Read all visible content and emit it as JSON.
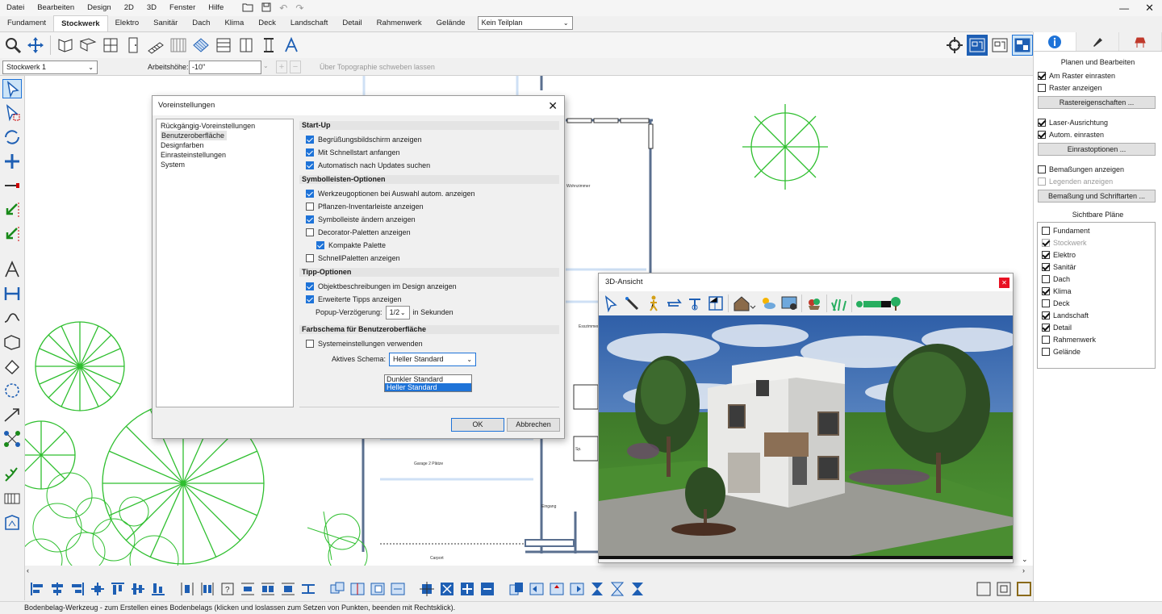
{
  "menu": [
    "Datei",
    "Bearbeiten",
    "Design",
    "2D",
    "3D",
    "Fenster",
    "Hilfe"
  ],
  "tabs": [
    "Fundament",
    "Stockwerk",
    "Elektro",
    "Sanitär",
    "Dach",
    "Klima",
    "Deck",
    "Landschaft",
    "Detail",
    "Rahmenwerk",
    "Gelände"
  ],
  "active_tab": "Stockwerk",
  "plan_select": "Kein Teilplan",
  "options_bar": {
    "floor_select": "Stockwerk 1",
    "height_label": "Arbeitshöhe:",
    "height_value": "-10\"",
    "topo_label": "Über Topographie schweben lassen"
  },
  "right_panel": {
    "title": "Planen und Bearbeiten",
    "snap_grid": "Am Raster einrasten",
    "show_grid": "Raster anzeigen",
    "grid_props_btn": "Rastereigenschaften ...",
    "laser": "Laser-Ausrichtung",
    "auto_snap": "Autom. einrasten",
    "snap_opts_btn": "Einrastoptionen ...",
    "show_dims": "Bemaßungen anzeigen",
    "show_legends": "Legenden anzeigen",
    "dims_fonts_btn": "Bemaßung und Schriftarten ...",
    "visible_plans_title": "Sichtbare Pläne",
    "visible_plans": [
      {
        "label": "Fundament",
        "checked": false
      },
      {
        "label": "Stockwerk",
        "checked": true,
        "grey": true
      },
      {
        "label": "Elektro",
        "checked": true
      },
      {
        "label": "Sanitär",
        "checked": true
      },
      {
        "label": "Dach",
        "checked": false
      },
      {
        "label": "Klima",
        "checked": true
      },
      {
        "label": "Deck",
        "checked": false
      },
      {
        "label": "Landschaft",
        "checked": true
      },
      {
        "label": "Detail",
        "checked": true
      },
      {
        "label": "Rahmenwerk",
        "checked": false
      },
      {
        "label": "Gelände",
        "checked": false
      }
    ]
  },
  "dialog": {
    "title": "Voreinstellungen",
    "nav": [
      "Rückgängig-Voreinstellungen",
      "Benutzeroberfläche",
      "Designfarben",
      "Einrasteinstellungen",
      "System"
    ],
    "nav_selected": 1,
    "startup_title": "Start-Up",
    "startup": [
      {
        "label": "Begrüßungsbildschirm anzeigen",
        "checked": true
      },
      {
        "label": "Mit Schnellstart anfangen",
        "checked": true
      },
      {
        "label": "Automatisch nach Updates suchen",
        "checked": true
      }
    ],
    "toolbar_title": "Symbolleisten-Optionen",
    "toolbar": [
      {
        "label": "Werkzeugoptionen bei Auswahl autom. anzeigen",
        "checked": true
      },
      {
        "label": "Pflanzen-Inventarleiste anzeigen",
        "checked": false
      },
      {
        "label": "Symbolleiste ändern anzeigen",
        "checked": true
      },
      {
        "label": "Decorator-Paletten anzeigen",
        "checked": false
      },
      {
        "label": "Kompakte Palette",
        "checked": true,
        "indent": true
      },
      {
        "label": "SchnellPaletten anzeigen",
        "checked": false
      }
    ],
    "tips_title": "Tipp-Optionen",
    "tips": [
      {
        "label": "Objektbeschreibungen im Design anzeigen",
        "checked": true
      },
      {
        "label": "Erweiterte Tipps anzeigen",
        "checked": true
      }
    ],
    "popup_delay_label": "Popup-Verzögerung:",
    "popup_delay_value": "1/2",
    "popup_delay_unit": "in Sekunden",
    "color_title": "Farbschema für Benutzeroberfläche",
    "use_system": {
      "label": "Systemeinstellungen verwenden",
      "checked": false
    },
    "scheme_label": "Aktives Schema:",
    "scheme_value": "Heller Standard",
    "scheme_options": [
      "Dunkler Standard",
      "Heller Standard"
    ],
    "ok": "OK",
    "cancel": "Abbrechen"
  },
  "view3d": {
    "title": "3D-Ansicht"
  },
  "plan_labels": {
    "room1": "Wohnzimmer",
    "room2": "Esszimmer",
    "garage": "Garage 2 Plätze",
    "entry": "Eingang",
    "carport": "Carport",
    "small": "Sp."
  },
  "status": "Bodenbelag-Werkzeug - zum Erstellen eines Bodenbelags (klicken und loslassen zum Setzen von Punkten, beenden mit Rechtsklick)."
}
